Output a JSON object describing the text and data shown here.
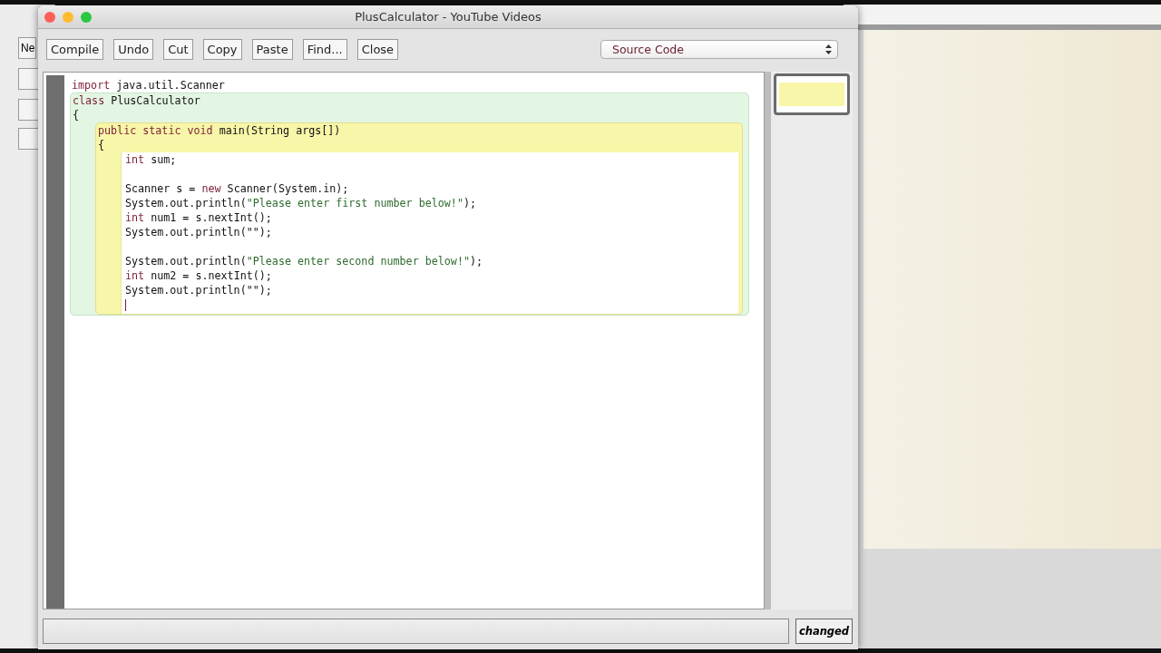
{
  "background_window": {
    "button_label": "Ne"
  },
  "window": {
    "title": "PlusCalculator - YouTube Videos"
  },
  "toolbar": {
    "buttons": [
      "Compile",
      "Undo",
      "Cut",
      "Copy",
      "Paste",
      "Find...",
      "Close"
    ],
    "view_select": {
      "value": "Source Code"
    }
  },
  "editor": {
    "lines": [
      {
        "kind": "code",
        "segments": [
          {
            "kind": "keyword",
            "text": "import"
          },
          {
            "kind": "plain",
            "text": " java.util.Scanner"
          }
        ]
      }
    ],
    "scopes": [
      {
        "kind": "class",
        "lines": [
          {
            "kind": "code",
            "segments": [
              {
                "kind": "keyword",
                "text": "class"
              },
              {
                "kind": "plain",
                "text": " PlusCalculator"
              }
            ]
          },
          {
            "kind": "code",
            "segments": [
              {
                "kind": "plain",
                "text": "{"
              }
            ]
          }
        ],
        "children": [
          {
            "kind": "method",
            "lines": [
              {
                "kind": "code",
                "segments": [
                  {
                    "kind": "keyword",
                    "text": "public static void"
                  },
                  {
                    "kind": "plain",
                    "text": " main(String args[])"
                  }
                ]
              },
              {
                "kind": "code",
                "segments": [
                  {
                    "kind": "plain",
                    "text": "{"
                  }
                ]
              }
            ],
            "children": [
              {
                "kind": "body",
                "lines": [
                  {
                    "kind": "code",
                    "segments": [
                      {
                        "kind": "keyword",
                        "text": "int"
                      },
                      {
                        "kind": "plain",
                        "text": " sum;"
                      }
                    ]
                  },
                  {
                    "kind": "blank"
                  },
                  {
                    "kind": "code",
                    "segments": [
                      {
                        "kind": "plain",
                        "text": "Scanner s = "
                      },
                      {
                        "kind": "keyword",
                        "text": "new"
                      },
                      {
                        "kind": "plain",
                        "text": " Scanner(System.in);"
                      }
                    ]
                  },
                  {
                    "kind": "code",
                    "segments": [
                      {
                        "kind": "plain",
                        "text": "System.out.println("
                      },
                      {
                        "kind": "string",
                        "text": "\"Please enter first number below!\""
                      },
                      {
                        "kind": "plain",
                        "text": ");"
                      }
                    ]
                  },
                  {
                    "kind": "code",
                    "segments": [
                      {
                        "kind": "keyword",
                        "text": "int"
                      },
                      {
                        "kind": "plain",
                        "text": " num1 = s.nextInt();"
                      }
                    ]
                  },
                  {
                    "kind": "code",
                    "segments": [
                      {
                        "kind": "plain",
                        "text": "System.out.println(\"\");"
                      }
                    ]
                  },
                  {
                    "kind": "blank"
                  },
                  {
                    "kind": "code",
                    "segments": [
                      {
                        "kind": "plain",
                        "text": "System.out.println("
                      },
                      {
                        "kind": "string",
                        "text": "\"Please enter second number below!\""
                      },
                      {
                        "kind": "plain",
                        "text": ");"
                      }
                    ]
                  },
                  {
                    "kind": "code",
                    "segments": [
                      {
                        "kind": "keyword",
                        "text": "int"
                      },
                      {
                        "kind": "plain",
                        "text": " num2 = s.nextInt();"
                      }
                    ]
                  },
                  {
                    "kind": "code",
                    "segments": [
                      {
                        "kind": "plain",
                        "text": "System.out.println(\"\");"
                      }
                    ]
                  },
                  {
                    "kind": "caret"
                  }
                ]
              }
            ]
          }
        ]
      }
    ]
  },
  "status_bar": {
    "badge": "changed"
  }
}
